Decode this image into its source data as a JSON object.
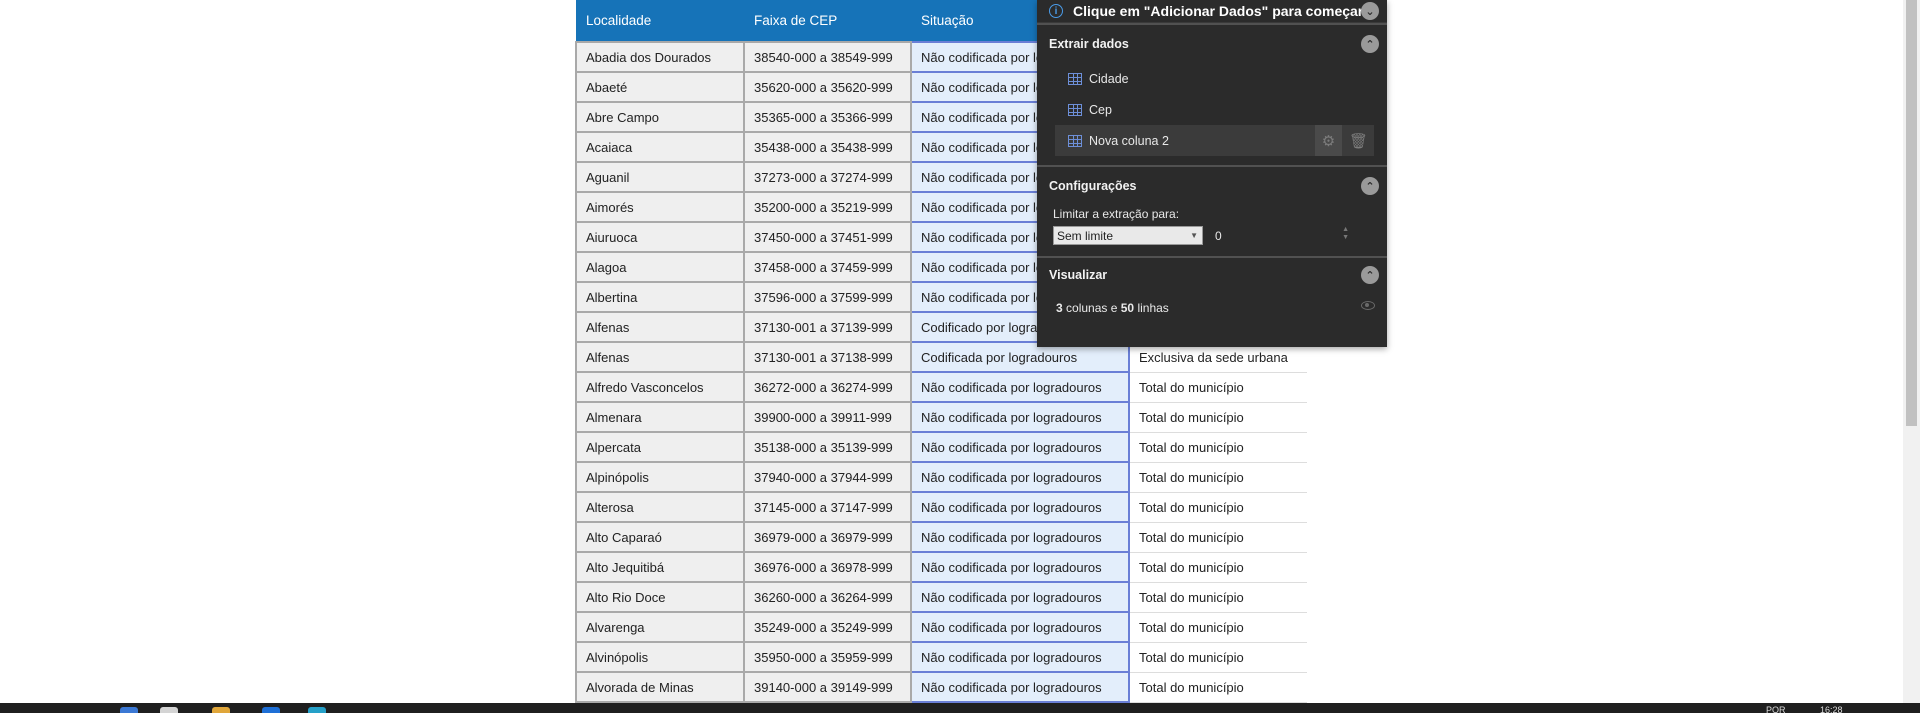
{
  "table": {
    "headers": [
      "Localidade",
      "Faixa de CEP",
      "Situação",
      ""
    ],
    "rows": [
      [
        "Abadia dos Dourados",
        "38540-000 a 38549-999",
        "Não codificada por logradouros",
        ""
      ],
      [
        "Abaeté",
        "35620-000 a 35620-999",
        "Não codificada por logradouros",
        ""
      ],
      [
        "Abre Campo",
        "35365-000 a 35366-999",
        "Não codificada por logradouros",
        ""
      ],
      [
        "Acaiaca",
        "35438-000 a 35438-999",
        "Não codificada por logradouros",
        ""
      ],
      [
        "Aguanil",
        "37273-000 a 37274-999",
        "Não codificada por logradouros",
        ""
      ],
      [
        "Aimorés",
        "35200-000 a 35219-999",
        "Não codificada por logradouros",
        ""
      ],
      [
        "Aiuruoca",
        "37450-000 a 37451-999",
        "Não codificada por logradouros",
        ""
      ],
      [
        "Alagoa",
        "37458-000 a 37459-999",
        "Não codificada por logradouros",
        ""
      ],
      [
        "Albertina",
        "37596-000 a 37599-999",
        "Não codificada por logradouros",
        ""
      ],
      [
        "Alfenas",
        "37130-001 a 37139-999",
        "Codificado por logradouros",
        ""
      ],
      [
        "Alfenas",
        "37130-001 a 37138-999",
        "Codificada por logradouros",
        "Exclusiva da sede urbana"
      ],
      [
        "Alfredo Vasconcelos",
        "36272-000 a 36274-999",
        "Não codificada por logradouros",
        "Total do município"
      ],
      [
        "Almenara",
        "39900-000 a 39911-999",
        "Não codificada por logradouros",
        "Total do município"
      ],
      [
        "Alpercata",
        "35138-000 a 35139-999",
        "Não codificada por logradouros",
        "Total do município"
      ],
      [
        "Alpinópolis",
        "37940-000 a 37944-999",
        "Não codificada por logradouros",
        "Total do município"
      ],
      [
        "Alterosa",
        "37145-000 a 37147-999",
        "Não codificada por logradouros",
        "Total do município"
      ],
      [
        "Alto Caparaó",
        "36979-000 a 36979-999",
        "Não codificada por logradouros",
        "Total do município"
      ],
      [
        "Alto Jequitibá",
        "36976-000 a 36978-999",
        "Não codificada por logradouros",
        "Total do município"
      ],
      [
        "Alto Rio Doce",
        "36260-000 a 36264-999",
        "Não codificada por logradouros",
        "Total do município"
      ],
      [
        "Alvarenga",
        "35249-000 a 35249-999",
        "Não codificada por logradouros",
        "Total do município"
      ],
      [
        "Alvinópolis",
        "35950-000 a 35959-999",
        "Não codificada por logradouros",
        "Total do município"
      ],
      [
        "Alvorada de Minas",
        "39140-000 a 39149-999",
        "Não codificada por logradouros",
        "Total do município"
      ]
    ]
  },
  "panel": {
    "header_title": "Clique em \"Adicionar Dados\" para começar",
    "extract_title": "Extrair dados",
    "columns": [
      "Cidade",
      "Cep",
      "Nova coluna 2"
    ],
    "config_title": "Configurações",
    "limit_label": "Limitar a extração para:",
    "limit_select": "Sem limite",
    "limit_value": "0",
    "visualize_title": "Visualizar",
    "summary_cols": "3",
    "summary_cols_text": "colunas e",
    "summary_rows": "50",
    "summary_rows_text": "linhas"
  },
  "taskbar": {
    "lang": "POR",
    "time": "16:28"
  },
  "icons": {
    "info": "info-icon",
    "collapse": "chevron-up-icon",
    "expand": "chevron-down-icon",
    "column": "table-icon",
    "settings": "gear-icon",
    "delete": "trash-icon",
    "preview": "eye-icon"
  }
}
